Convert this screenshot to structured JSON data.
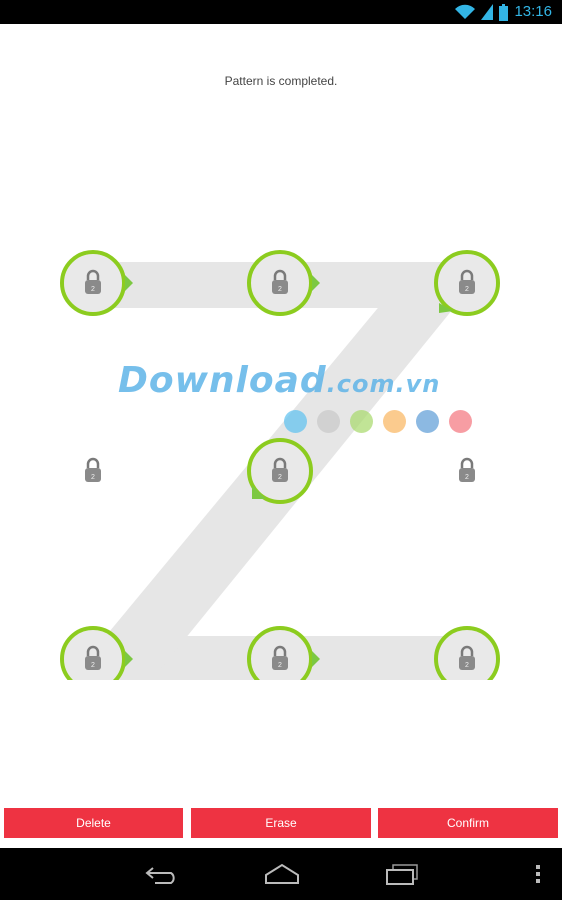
{
  "status_bar": {
    "time": "13:16",
    "icons": [
      "wifi-icon",
      "signal-icon",
      "battery-icon"
    ],
    "icon_color": "#33b5e5"
  },
  "message": "Pattern is completed.",
  "pattern": {
    "grid": "3x3",
    "selected_sequence": [
      1,
      2,
      3,
      5,
      7,
      8,
      9
    ],
    "unselected_nodes": [
      4,
      6
    ],
    "ring_color": "#8ccc1f",
    "track_color": "#e6e6e6",
    "arrow_color": "#7cc842",
    "node_icon": "padlock-icon",
    "node_badge": "2"
  },
  "watermark": {
    "text": "Download",
    "suffix": ".com.vn",
    "dot_colors": [
      "#5bc0f0",
      "#c8c8c8",
      "#a6d96a",
      "#f9b55e",
      "#5b9bd5",
      "#f4747c"
    ]
  },
  "buttons": {
    "delete": "Delete",
    "erase": "Erase",
    "confirm": "Confirm"
  },
  "nav_bar": {
    "icons": [
      "back-icon",
      "home-icon",
      "recent-apps-icon",
      "overflow-menu-icon"
    ]
  }
}
